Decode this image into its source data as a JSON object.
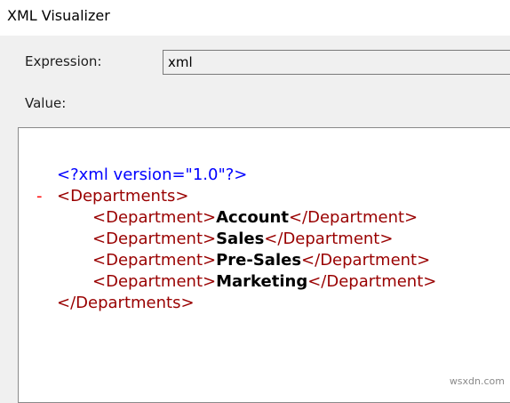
{
  "window": {
    "title": "XML Visualizer"
  },
  "expression": {
    "label": "Expression:",
    "value": "xml"
  },
  "value_section": {
    "label": "Value:"
  },
  "xml": {
    "declaration": "<?xml version=\"1.0\"?>",
    "collapse_marker": "-",
    "root_open": "<Departments>",
    "child_open_tag": "<Department>",
    "child_close_tag": "</Department>",
    "children": [
      "Account",
      "Sales",
      "Pre-Sales",
      "Marketing"
    ],
    "root_close": "</Departments>"
  },
  "watermark": "wsxdn.com",
  "colors": {
    "processing_instruction": "#0000ff",
    "element_tag": "#990000",
    "element_text": "#000000",
    "collapse_marker": "#ff0000"
  }
}
